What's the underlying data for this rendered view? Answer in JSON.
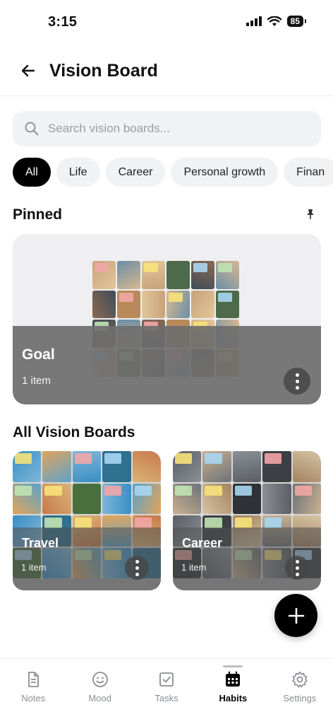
{
  "status_bar": {
    "time": "3:15",
    "battery": "85"
  },
  "header": {
    "title": "Vision Board"
  },
  "search": {
    "placeholder": "Search vision boards..."
  },
  "filters": [
    "All",
    "Life",
    "Career",
    "Personal growth",
    "Finan"
  ],
  "pinned": {
    "title": "Pinned",
    "card": {
      "name": "Goal",
      "count": "1 item"
    }
  },
  "all_boards": {
    "title": "All Vision Boards",
    "boards": [
      {
        "name": "Travel",
        "count": "1 item"
      },
      {
        "name": "Career",
        "count": "1 item"
      }
    ]
  },
  "tabs": [
    {
      "label": "Notes",
      "icon": "notes-icon"
    },
    {
      "label": "Mood",
      "icon": "smiley-icon"
    },
    {
      "label": "Tasks",
      "icon": "checkbox-icon"
    },
    {
      "label": "Habits",
      "icon": "calendar-icon"
    },
    {
      "label": "Settings",
      "icon": "gear-icon"
    }
  ],
  "colors": {
    "accent": "#000000",
    "chip_bg": "#f1f2f4",
    "overlay": "#6e6e6e",
    "muted_text": "#8a8d93"
  }
}
